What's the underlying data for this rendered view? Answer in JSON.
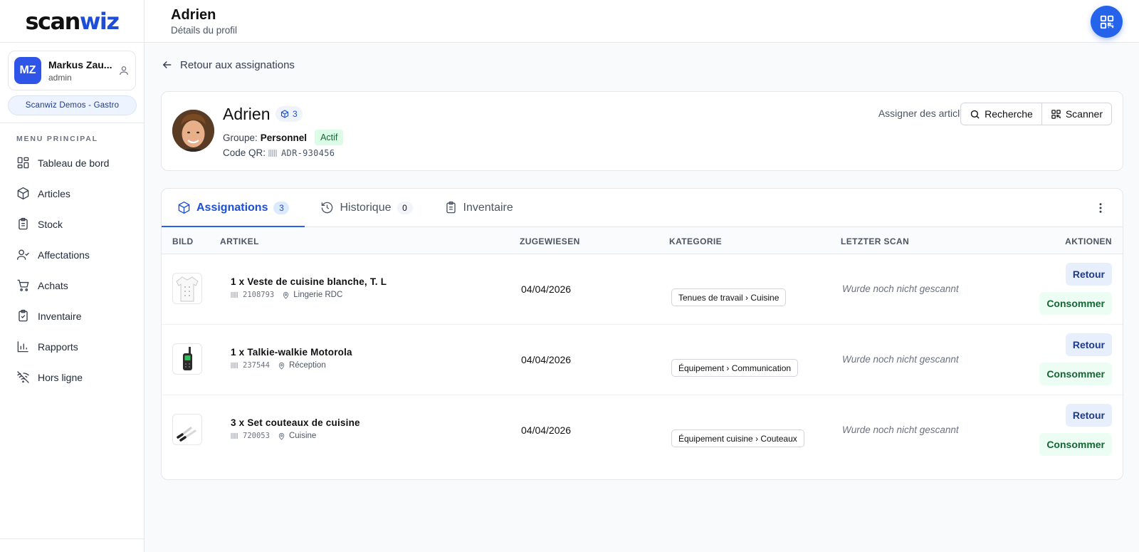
{
  "brand": {
    "logo_part1": "scan",
    "logo_part2": "wiz",
    "accent": "#2563eb"
  },
  "user": {
    "initials": "MZ",
    "name": "Markus Zau...",
    "role": "admin",
    "org": "Scanwiz Demos - Gastro"
  },
  "sidebar": {
    "menu_title": "MENU PRINCIPAL",
    "items": [
      {
        "label": "Tableau de bord",
        "icon": "dashboard-icon"
      },
      {
        "label": "Articles",
        "icon": "box-icon"
      },
      {
        "label": "Stock",
        "icon": "clipboard-icon"
      },
      {
        "label": "Affectations",
        "icon": "user-check-icon"
      },
      {
        "label": "Achats",
        "icon": "cart-icon"
      },
      {
        "label": "Inventaire",
        "icon": "clipboard-check-icon"
      },
      {
        "label": "Rapports",
        "icon": "bar-chart-icon"
      },
      {
        "label": "Hors ligne",
        "icon": "wifi-off-icon"
      }
    ]
  },
  "header": {
    "title": "Adrien",
    "subtitle": "Détails du profil"
  },
  "back_link": "Retour aux assignations",
  "profile": {
    "name": "Adrien",
    "count": "3",
    "group_label": "Groupe:",
    "group_value": "Personnel",
    "status": "Actif",
    "qr_label": "Code QR:",
    "qr_value": "ADR-930456",
    "assign_label": "Assigner des articles",
    "search_button": "Recherche",
    "scan_button": "Scanner"
  },
  "tabs": [
    {
      "label": "Assignations",
      "count": "3"
    },
    {
      "label": "Historique",
      "count": "0"
    },
    {
      "label": "Inventaire"
    }
  ],
  "table": {
    "columns": {
      "image": "BILD",
      "article": "ARTIKEL",
      "assigned": "ZUGEWIESEN",
      "category": "KATEGORIE",
      "last_scan": "LETZTER SCAN",
      "actions": "AKTIONEN"
    },
    "rows": [
      {
        "title": "1 x Veste de cuisine blanche, T. L",
        "code": "2108793",
        "location": "Lingerie RDC",
        "date": "04/04/2026",
        "category": "Tenues de travail › Cuisine",
        "last_scan": "Wurde noch nicht gescannt",
        "btn_return": "Retour",
        "btn_consume": "Consommer"
      },
      {
        "title": "1 x Talkie-walkie Motorola",
        "code": "237544",
        "location": "Réception",
        "date": "04/04/2026",
        "category": "Équipement › Communication",
        "last_scan": "Wurde noch nicht gescannt",
        "btn_return": "Retour",
        "btn_consume": "Consommer"
      },
      {
        "title": "3 x Set couteaux de cuisine",
        "code": "720053",
        "location": "Cuisine",
        "date": "04/04/2026",
        "category": "Équipement cuisine › Couteaux",
        "last_scan": "Wurde noch nicht gescannt",
        "btn_return": "Retour",
        "btn_consume": "Consommer"
      }
    ]
  }
}
